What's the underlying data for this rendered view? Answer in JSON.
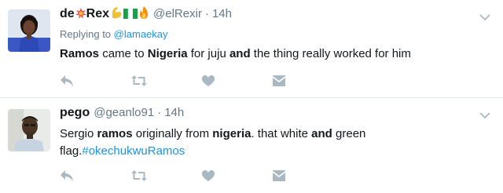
{
  "tweets": [
    {
      "name": "de",
      "name_emojis": [
        "explosion-emoji",
        "flexed-biceps-emoji",
        "nigeria-flag-emoji",
        "fire-emoji"
      ],
      "name_suffix": "Rex",
      "handle": "@elRexir",
      "separator": "·",
      "time": "14h",
      "reply_prefix": "Replying to",
      "reply_to": "@lamaekay",
      "text_parts": [
        {
          "t": "Ramos",
          "bold": true
        },
        {
          "t": " came to ",
          "bold": false
        },
        {
          "t": "Nigeria",
          "bold": true
        },
        {
          "t": " for juju ",
          "bold": false
        },
        {
          "t": "and",
          "bold": true
        },
        {
          "t": " the thing really worked for him",
          "bold": false
        }
      ]
    },
    {
      "name": "pego",
      "handle": "@geanlo91",
      "separator": "·",
      "time": "14h",
      "text_parts": [
        {
          "t": "Sergio ",
          "bold": false
        },
        {
          "t": "ramos",
          "bold": true
        },
        {
          "t": " originally from ",
          "bold": false
        },
        {
          "t": "nigeria",
          "bold": true
        },
        {
          "t": ". that white ",
          "bold": false
        },
        {
          "t": "and",
          "bold": true
        },
        {
          "t": " green flag.",
          "bold": false
        }
      ],
      "hashtag": "#okechukwuRamos"
    }
  ],
  "actions": [
    "reply-icon",
    "retweet-icon",
    "like-icon",
    "direct-message-icon"
  ],
  "colors": {
    "icon": "#aab8c2",
    "link": "#1b95e0",
    "muted": "#657786",
    "text": "#14171a",
    "divider": "#e1e8ed"
  }
}
